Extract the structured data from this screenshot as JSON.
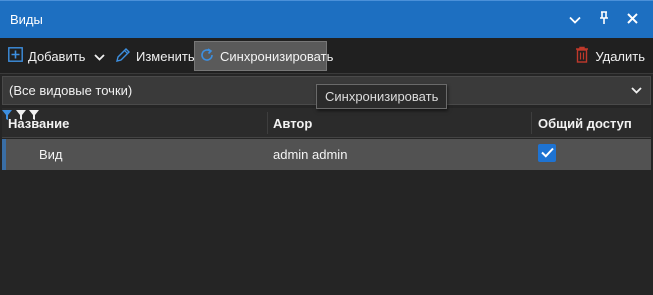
{
  "window": {
    "title": "Виды"
  },
  "toolbar": {
    "add_label": "Добавить",
    "edit_label": "Изменить",
    "sync_label": "Синхронизировать",
    "delete_label": "Удалить"
  },
  "filter": {
    "selected": "(Все видовые точки)"
  },
  "tooltip": {
    "text": "Синхронизировать"
  },
  "grid": {
    "columns": [
      "Название",
      "Автор",
      "Общий доступ"
    ],
    "rows": [
      {
        "name": "Вид",
        "author": "admin admin",
        "shared": true
      }
    ]
  },
  "colors": {
    "titlebar": "#1d6fc1",
    "accent": "#1e73d2",
    "delete_icon": "#c0392b"
  },
  "icons": {
    "add": "plus-box-icon",
    "edit": "pencil-icon",
    "sync": "sync-icon",
    "delete": "trash-icon"
  }
}
